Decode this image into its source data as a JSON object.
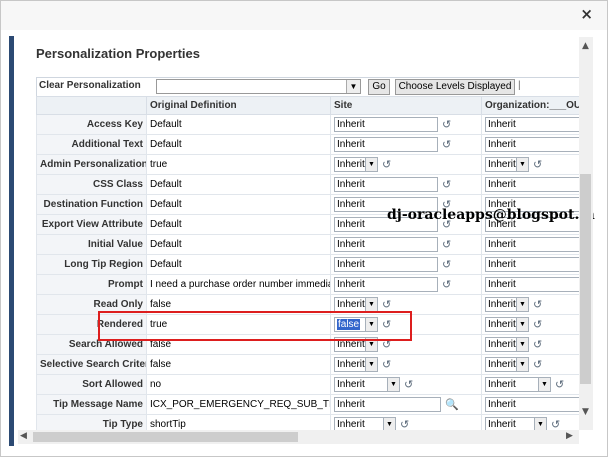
{
  "dialog": {
    "close_label": "×"
  },
  "page_title": "Personalization Properties",
  "toolbar": {
    "clear_label": "Clear Personalization",
    "go_label": "Go",
    "choose_label": "Choose Levels Displayed",
    "divider": "|"
  },
  "columns": {
    "original": "Original Definition",
    "site": "Site",
    "organization": "Organization:___OU"
  },
  "rows": [
    {
      "label": "Access Key",
      "original": "Default",
      "site": "Inherit",
      "site_type": "input",
      "org": "Inherit"
    },
    {
      "label": "Additional Text",
      "original": "Default",
      "site": "Inherit",
      "site_type": "input",
      "org": "Inherit"
    },
    {
      "label": "Admin Personalization",
      "original": "true",
      "site": "Inherit",
      "site_type": "select",
      "org": "Inherit"
    },
    {
      "label": "CSS Class",
      "original": "Default",
      "site": "Inherit",
      "site_type": "input",
      "org": "Inherit"
    },
    {
      "label": "Destination Function",
      "original": "Default",
      "site": "Inherit",
      "site_type": "input",
      "org": "Inherit"
    },
    {
      "label": "Export View Attribute",
      "original": "Default",
      "site": "Inherit",
      "site_type": "input",
      "org": "Inherit"
    },
    {
      "label": "Initial Value",
      "original": "Default",
      "site": "Inherit",
      "site_type": "input",
      "org": "Inherit"
    },
    {
      "label": "Long Tip Region",
      "original": "Default",
      "site": "Inherit",
      "site_type": "input",
      "org": "Inherit"
    },
    {
      "label": "Prompt",
      "original": "I need a purchase order number immediately",
      "site": "Inherit",
      "site_type": "input",
      "org": "Inherit"
    },
    {
      "label": "Read Only",
      "original": "false",
      "site": "Inherit",
      "site_type": "select",
      "org": "Inherit"
    },
    {
      "label": "Rendered",
      "original": "true",
      "site": "false",
      "site_type": "select",
      "org": "Inherit"
    },
    {
      "label": "Search Allowed",
      "original": "false",
      "site": "Inherit",
      "site_type": "select",
      "org": "Inherit"
    },
    {
      "label": "Selective Search Criteria",
      "original": "false",
      "site": "Inherit",
      "site_type": "select",
      "org": "Inherit"
    },
    {
      "label": "Sort Allowed",
      "original": "no",
      "site": "Inherit",
      "site_type": "select",
      "org": "Inherit"
    },
    {
      "label": "Tip Message Name",
      "original": "ICX_POR_EMERGENCY_REQ_SUB_TIP",
      "site": "Inherit",
      "site_type": "lov",
      "org": "Inherit"
    },
    {
      "label": "Tip Type",
      "original": "shortTip",
      "site": "Inherit",
      "site_type": "select",
      "org": "Inherit"
    }
  ],
  "watermark": "dj-oracleapps@blogspot.in",
  "colors": {
    "accent_bar": "#2c4a73",
    "highlight_box": "#dd1e1e",
    "selection": "#3366cc"
  }
}
